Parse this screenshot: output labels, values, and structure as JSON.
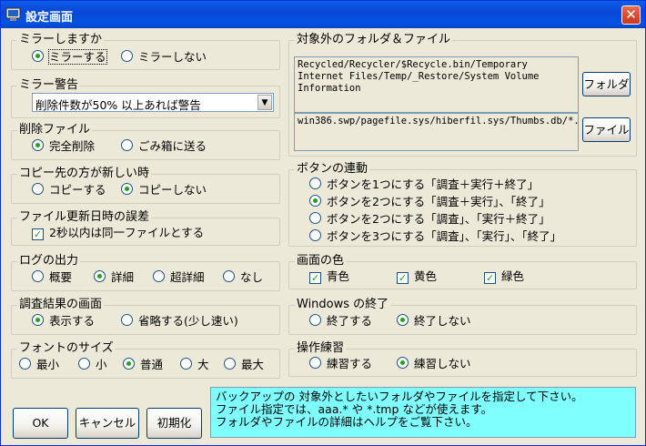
{
  "window": {
    "title": "設定画面"
  },
  "mirror": {
    "legend": "ミラーしますか",
    "options": [
      "ミラーする",
      "ミラーしない"
    ],
    "selected": 0
  },
  "mirror_warning": {
    "legend": "ミラー警告",
    "value": "削除件数が50% 以上あれば警告"
  },
  "delete_file": {
    "legend": "削除ファイル",
    "options": [
      "完全削除",
      "ごみ箱に送る"
    ],
    "selected": 0
  },
  "copy_newer": {
    "legend": "コピー先の方が新しい時",
    "options": [
      "コピーする",
      "コピーしない"
    ],
    "selected": 1
  },
  "time_error": {
    "legend": "ファイル更新日時の誤差",
    "checkbox_label": "2秒以内は同一ファイルとする",
    "checked": true
  },
  "log_output": {
    "legend": "ログの出力",
    "options": [
      "概要",
      "詳細",
      "超詳細",
      "なし"
    ],
    "selected": 1
  },
  "result_screen": {
    "legend": "調査結果の画面",
    "options": [
      "表示する",
      "省略する(少し速い)"
    ],
    "selected": 0
  },
  "font_size": {
    "legend": "フォントのサイズ",
    "options": [
      "最小",
      "小",
      "普通",
      "大",
      "最大"
    ],
    "selected": 2
  },
  "excluded": {
    "legend": "対象外のフォルダ＆ファイル",
    "folders_text": "Recycled/Recycler/$Recycle.bin/Temporary Internet Files/Temp/_Restore/System Volume Information",
    "files_text": "win386.swp/pagefile.sys/hiberfil.sys/Thumbs.db/*.tmp",
    "folder_button": "フォルダ",
    "file_button": "ファイル"
  },
  "button_link": {
    "legend": "ボタンの連動",
    "options": [
      "ボタンを1つにする「調査＋実行＋終了」",
      "ボタンを2つにする「調査＋実行」、「終了」",
      "ボタンを2つにする「調査」、「実行＋終了」",
      "ボタンを3つにする「調査」、「実行」、「終了」"
    ],
    "selected": 1
  },
  "screen_color": {
    "legend": "画面の色",
    "options": [
      "青色",
      "黄色",
      "緑色"
    ],
    "checked": [
      true,
      true,
      true
    ]
  },
  "windows_exit": {
    "legend": "Windows の終了",
    "options": [
      "終了する",
      "終了しない"
    ],
    "selected": 1
  },
  "practice": {
    "legend": "操作練習",
    "options": [
      "練習する",
      "練習しない"
    ],
    "selected": 1
  },
  "buttons": {
    "ok": "OK",
    "cancel": "キャンセル",
    "reset": "初期化"
  },
  "info": {
    "lines": [
      "バックアップの 対象外としたいフォルダやファイルを指定して下さい。",
      "ファイル指定では、aaa.* や *.tmp などが使えます。",
      "フォルダやファイルの詳細はヘルプをご覧下さい。"
    ]
  },
  "colors": {
    "title_bar": "#0A46D6",
    "info_bg": "#80FFFF",
    "dialog_bg": "#ECE9D8",
    "radio_dot": "#21A121"
  }
}
